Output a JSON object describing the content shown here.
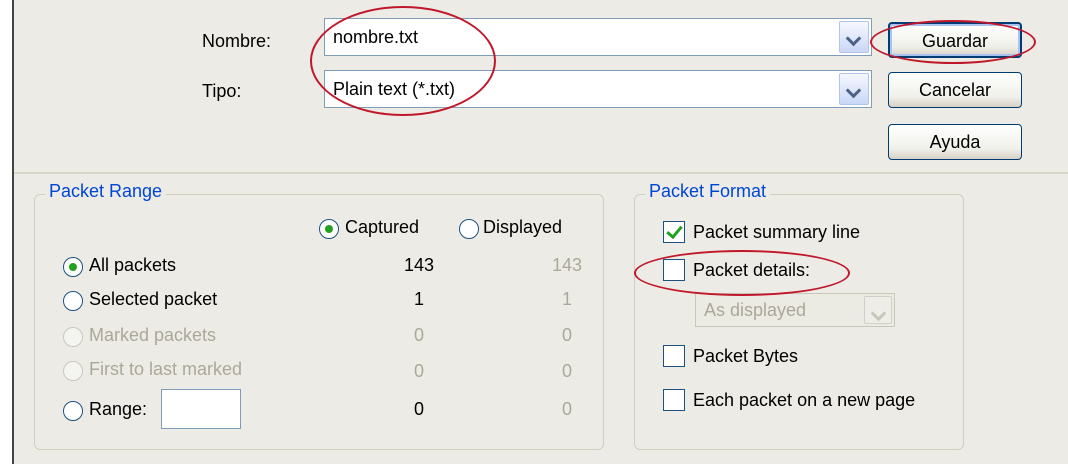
{
  "file": {
    "name_label": "Nombre:",
    "name_value": "nombre.txt",
    "type_label": "Tipo:",
    "type_value": "Plain text (*.txt)"
  },
  "buttons": {
    "save": "Guardar",
    "cancel": "Cancelar",
    "help": "Ayuda"
  },
  "packet_range": {
    "title": "Packet Range",
    "captured_label": "Captured",
    "displayed_label": "Displayed",
    "rows": [
      {
        "label": "All packets",
        "captured": "143",
        "displayed": "143"
      },
      {
        "label": "Selected packet",
        "captured": "1",
        "displayed": "1"
      },
      {
        "label": "Marked packets",
        "captured": "0",
        "displayed": "0"
      },
      {
        "label": "First to last marked",
        "captured": "0",
        "displayed": "0"
      },
      {
        "label": "Range:",
        "captured": "0",
        "displayed": "0"
      }
    ],
    "range_value": ""
  },
  "packet_format": {
    "title": "Packet Format",
    "summary_line": "Packet summary line",
    "details": "Packet details:",
    "details_option": "As displayed",
    "bytes": "Packet Bytes",
    "new_page": "Each packet on a new page"
  },
  "colors": {
    "dialog_bg": "#ecebe6",
    "legend_blue": "#0046d5",
    "annotation_red": "#c0182a",
    "check_green": "#21a121"
  }
}
